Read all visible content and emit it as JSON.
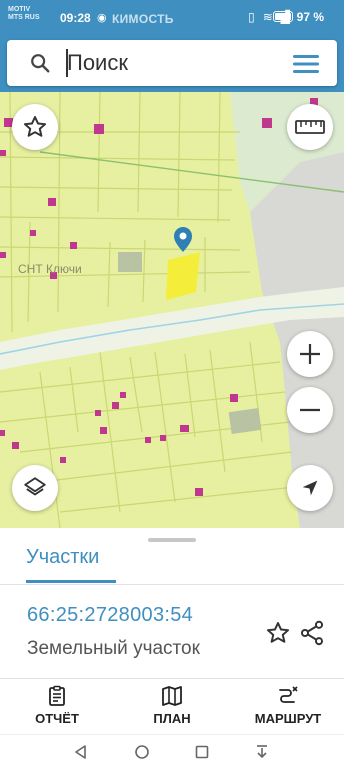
{
  "status": {
    "operator_top": "MOTIV",
    "operator_bottom": "MTS RUS",
    "time": "09:28",
    "app_overlay": "КИМОСТЬ",
    "battery_percent": "97 %"
  },
  "search": {
    "placeholder": "Поиск"
  },
  "map": {
    "settlement_label": "СНТ Ключи",
    "buttons": [
      "favorites-star",
      "ruler",
      "zoom-in",
      "zoom-out",
      "layers",
      "my-location"
    ]
  },
  "sheet": {
    "tab_label": "Участки",
    "cadastral_number": "66:25:2728003:54",
    "object_type": "Земельный участок"
  },
  "actions": {
    "report": "ОТЧЁТ",
    "plan": "ПЛАН",
    "route": "МАРШРУТ"
  },
  "colors": {
    "brand": "#3f8fc0",
    "map_fill": "#e7f0a0",
    "parcel_line": "#c9d774",
    "selected_parcel": "#f4ee3a",
    "building": "#c0388e"
  }
}
